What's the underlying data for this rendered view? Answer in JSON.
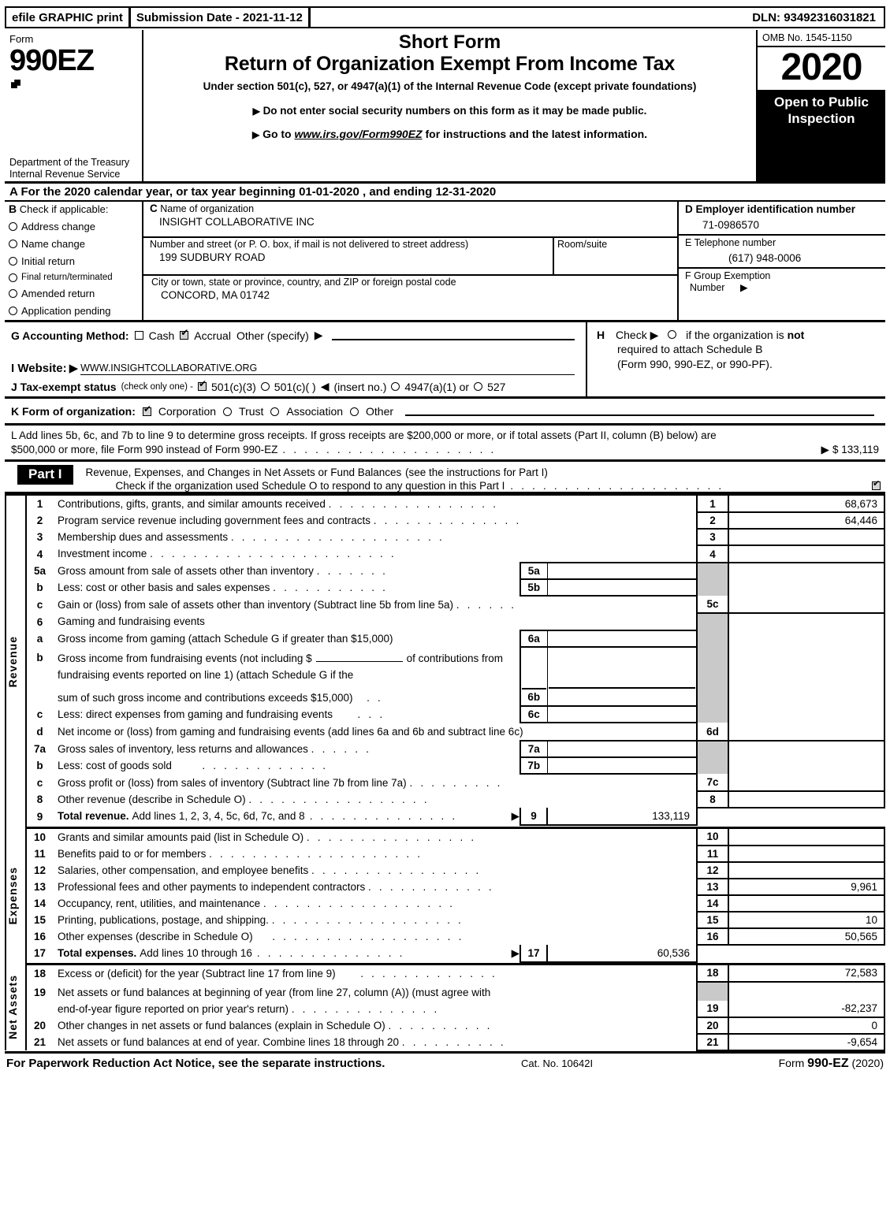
{
  "efile": {
    "print_label": "efile GRAPHIC print",
    "submission_label": "Submission Date - 2021-11-12",
    "dln": "DLN: 93492316031821"
  },
  "masthead": {
    "form_word": "Form",
    "form_number": "990EZ",
    "department": "Department of the Treasury Internal Revenue Service",
    "title_short": "Short Form",
    "title_main": "Return of Organization Exempt From Income Tax",
    "subtitle": "Under section 501(c), 527, or 4947(a)(1) of the Internal Revenue Code (except private foundations)",
    "bullet1": "Do not enter social security numbers on this form as it may be made public.",
    "bullet2_prefix": "Go to",
    "bullet2_link": "www.irs.gov/Form990EZ",
    "bullet2_suffix": "for instructions and the latest information.",
    "omb": "OMB No. 1545-1150",
    "year": "2020",
    "open_to_public": "Open to Public Inspection"
  },
  "line_a": "A  For the 2020 calendar year, or tax year beginning 01-01-2020 , and ending 12-31-2020",
  "section_b": {
    "letter": "B",
    "heading": "Check if applicable:",
    "items": [
      {
        "label": "Address change",
        "checked": false
      },
      {
        "label": "Name change",
        "checked": false
      },
      {
        "label": "Initial return",
        "checked": false
      },
      {
        "label": "Final return/terminated",
        "checked": false
      },
      {
        "label": "Amended return",
        "checked": false
      },
      {
        "label": "Application pending",
        "checked": false
      }
    ]
  },
  "section_c": {
    "letter": "C",
    "name_label": "Name of organization",
    "name_value": "INSIGHT COLLABORATIVE INC",
    "street_label": "Number and street (or P. O. box, if mail is not delivered to street address)",
    "street_value": "199 SUDBURY ROAD",
    "room_label": "Room/suite",
    "room_value": "",
    "city_label": "City or town, state or province, country, and ZIP or foreign postal code",
    "city_value": "CONCORD, MA  01742"
  },
  "section_d": {
    "ein_label": "D Employer identification number",
    "ein_value": "71-0986570",
    "phone_label": "E Telephone number",
    "phone_value": "(617) 948-0006",
    "group_label": "F Group Exemption",
    "group_label2": "Number",
    "group_value": ""
  },
  "section_g": {
    "label": "G Accounting Method:",
    "cash_label": "Cash",
    "cash_checked": false,
    "accrual_label": "Accrual",
    "accrual_checked": true,
    "other_label": "Other (specify)",
    "other_value": ""
  },
  "section_h": {
    "line1_a": "H",
    "line1_b": "Check",
    "line1_c": "if the organization is",
    "line1_not": "not",
    "line2": "required to attach Schedule B",
    "line3": "(Form 990, 990-EZ, or 990-PF)."
  },
  "section_i": {
    "label": "I Website:",
    "value": "WWW.INSIGHTCOLLABORATIVE.ORG"
  },
  "section_j": {
    "label": "J Tax-exempt status",
    "note": "(check only one) -",
    "opt1": "501(c)(3)",
    "opt1_checked": true,
    "opt2": "501(c)(    )",
    "opt2_checked": false,
    "insert": "(insert no.)",
    "opt3": "4947(a)(1) or",
    "opt3_checked": false,
    "opt4": "527",
    "opt4_checked": false
  },
  "section_k": {
    "label": "K Form of organization:",
    "opts": [
      {
        "label": "Corporation",
        "checked": true
      },
      {
        "label": "Trust",
        "checked": false
      },
      {
        "label": "Association",
        "checked": false
      },
      {
        "label": "Other",
        "checked": false
      }
    ]
  },
  "section_l": {
    "text1": "L Add lines 5b, 6c, and 7b to line 9 to determine gross receipts. If gross receipts are $200,000 or more, or if total assets (Part II, column (B) below) are",
    "text2": "$500,000 or more, file Form 990 instead of Form 990-EZ",
    "amount": "$ 133,119"
  },
  "part_i": {
    "badge": "Part I",
    "title": "Revenue, Expenses, and Changes in Net Assets or Fund Balances",
    "title_note": "(see the instructions for Part I)",
    "check_text": "Check if the organization used Schedule O to respond to any question in this Part I",
    "checked": true,
    "side_revenue": "Revenue",
    "side_expenses": "Expenses",
    "side_netassets": "Net Assets"
  },
  "chart_data": {
    "type": "table",
    "title": "Form 990-EZ Part I — Revenue, Expenses, and Changes in Net Assets",
    "revenue_rows": [
      {
        "no": "1",
        "sub": "",
        "desc": "Contributions, gifts, grants, and similar amounts received",
        "linelbl": "1",
        "value": "68,673"
      },
      {
        "no": "2",
        "sub": "",
        "desc": "Program service revenue including government fees and contracts",
        "linelbl": "2",
        "value": "64,446"
      },
      {
        "no": "3",
        "sub": "",
        "desc": "Membership dues and assessments",
        "linelbl": "3",
        "value": ""
      },
      {
        "no": "4",
        "sub": "",
        "desc": "Investment income",
        "linelbl": "4",
        "value": ""
      },
      {
        "no": "5a",
        "sub": "5a",
        "desc": "Gross amount from sale of assets other than inventory",
        "linelbl": "",
        "value": ""
      },
      {
        "no": "b",
        "sub": "5b",
        "desc": "Less: cost or other basis and sales expenses",
        "linelbl": "",
        "value": ""
      },
      {
        "no": "c",
        "sub": "",
        "desc": "Gain or (loss) from sale of assets other than inventory (Subtract line 5b from line 5a)",
        "linelbl": "5c",
        "value": ""
      },
      {
        "no": "6",
        "sub": "",
        "desc": "Gaming and fundraising events",
        "linelbl": "",
        "value": ""
      },
      {
        "no": "a",
        "sub": "6a",
        "desc": "Gross income from gaming (attach Schedule G if greater than $15,000)",
        "linelbl": "",
        "value": ""
      },
      {
        "no": "b",
        "sub": "6b",
        "desc": "Gross income from fundraising events (not including $______ of contributions from fundraising events reported on line 1) (attach Schedule G if the sum of such gross income and contributions exceeds $15,000)",
        "linelbl": "",
        "value": ""
      },
      {
        "no": "c",
        "sub": "6c",
        "desc": "Less: direct expenses from gaming and fundraising events",
        "linelbl": "",
        "value": ""
      },
      {
        "no": "d",
        "sub": "",
        "desc": "Net income or (loss) from gaming and fundraising events (add lines 6a and 6b and subtract line 6c)",
        "linelbl": "6d",
        "value": ""
      },
      {
        "no": "7a",
        "sub": "7a",
        "desc": "Gross sales of inventory, less returns and allowances",
        "linelbl": "",
        "value": ""
      },
      {
        "no": "b",
        "sub": "7b",
        "desc": "Less: cost of goods sold",
        "linelbl": "",
        "value": ""
      },
      {
        "no": "c",
        "sub": "",
        "desc": "Gross profit or (loss) from sales of inventory (Subtract line 7b from line 7a)",
        "linelbl": "7c",
        "value": ""
      },
      {
        "no": "8",
        "sub": "",
        "desc": "Other revenue (describe in Schedule O)",
        "linelbl": "8",
        "value": ""
      },
      {
        "no": "9",
        "sub": "",
        "desc": "Total revenue. Add lines 1, 2, 3, 4, 5c, 6d, 7c, and 8",
        "linelbl": "9",
        "value": "133,119"
      }
    ],
    "expense_rows": [
      {
        "no": "10",
        "desc": "Grants and similar amounts paid (list in Schedule O)",
        "linelbl": "10",
        "value": ""
      },
      {
        "no": "11",
        "desc": "Benefits paid to or for members",
        "linelbl": "11",
        "value": ""
      },
      {
        "no": "12",
        "desc": "Salaries, other compensation, and employee benefits",
        "linelbl": "12",
        "value": ""
      },
      {
        "no": "13",
        "desc": "Professional fees and other payments to independent contractors",
        "linelbl": "13",
        "value": "9,961"
      },
      {
        "no": "14",
        "desc": "Occupancy, rent, utilities, and maintenance",
        "linelbl": "14",
        "value": ""
      },
      {
        "no": "15",
        "desc": "Printing, publications, postage, and shipping.",
        "linelbl": "15",
        "value": "10"
      },
      {
        "no": "16",
        "desc": "Other expenses (describe in Schedule O)",
        "linelbl": "16",
        "value": "50,565"
      },
      {
        "no": "17",
        "desc": "Total expenses. Add lines 10 through 16",
        "linelbl": "17",
        "value": "60,536"
      }
    ],
    "netasset_rows": [
      {
        "no": "18",
        "desc": "Excess or (deficit) for the year (Subtract line 17 from line 9)",
        "linelbl": "18",
        "value": "72,583"
      },
      {
        "no": "19",
        "desc": "Net assets or fund balances at beginning of year (from line 27, column (A)) (must agree with end-of-year figure reported on prior year's return)",
        "linelbl": "19",
        "value": "-82,237"
      },
      {
        "no": "20",
        "desc": "Other changes in net assets or fund balances (explain in Schedule O)",
        "linelbl": "20",
        "value": "0"
      },
      {
        "no": "21",
        "desc": "Net assets or fund balances at end of year. Combine lines 18 through 20",
        "linelbl": "21",
        "value": "-9,654"
      }
    ]
  },
  "rows": {
    "r1_desc": "Contributions, gifts, grants, and similar amounts received",
    "r1_lbl": "1",
    "r1_val": "68,673",
    "r2_desc": "Program service revenue including government fees and contracts",
    "r2_lbl": "2",
    "r2_val": "64,446",
    "r3_desc": "Membership dues and assessments",
    "r3_lbl": "3",
    "r3_val": "",
    "r4_desc": "Investment income",
    "r4_lbl": "4",
    "r4_val": "",
    "r5a_no": "5a",
    "r5a_desc": "Gross amount from sale of assets other than inventory",
    "r5a_sub": "5a",
    "r5b_no": "b",
    "r5b_desc": "Less: cost or other basis and sales expenses",
    "r5b_sub": "5b",
    "r5c_no": "c",
    "r5c_desc": "Gain or (loss) from sale of assets other than inventory (Subtract line 5b from line 5a)",
    "r5c_lbl": "5c",
    "r5c_val": "",
    "r6_no": "6",
    "r6_desc": "Gaming and fundraising events",
    "r6a_no": "a",
    "r6a_desc": "Gross income from gaming (attach Schedule G if greater than $15,000)",
    "r6a_sub": "6a",
    "r6b_no": "b",
    "r6b_desc1": "Gross income from fundraising events (not including $",
    "r6b_desc1b": "of contributions from",
    "r6b_desc2": "fundraising events reported on line 1) (attach Schedule G if the",
    "r6b_desc3": "sum of such gross income and contributions exceeds $15,000)",
    "r6b_sub": "6b",
    "r6c_no": "c",
    "r6c_desc": "Less: direct expenses from gaming and fundraising events",
    "r6c_sub": "6c",
    "r6d_no": "d",
    "r6d_desc": "Net income or (loss) from gaming and fundraising events (add lines 6a and 6b and subtract line 6c)",
    "r6d_lbl": "6d",
    "r6d_val": "",
    "r7a_no": "7a",
    "r7a_desc": "Gross sales of inventory, less returns and allowances",
    "r7a_sub": "7a",
    "r7b_no": "b",
    "r7b_desc": "Less: cost of goods sold",
    "r7b_sub": "7b",
    "r7c_no": "c",
    "r7c_desc": "Gross profit or (loss) from sales of inventory (Subtract line 7b from line 7a)",
    "r7c_lbl": "7c",
    "r7c_val": "",
    "r8_no": "8",
    "r8_desc": "Other revenue (describe in Schedule O)",
    "r8_lbl": "8",
    "r8_val": "",
    "r9_no": "9",
    "r9_desc_b": "Total revenue.",
    "r9_desc": "Add lines 1, 2, 3, 4, 5c, 6d, 7c, and 8",
    "r9_lbl": "9",
    "r9_val": "133,119",
    "r10_no": "10",
    "r10_desc": "Grants and similar amounts paid (list in Schedule O)",
    "r10_lbl": "10",
    "r10_val": "",
    "r11_no": "11",
    "r11_desc": "Benefits paid to or for members",
    "r11_lbl": "11",
    "r11_val": "",
    "r12_no": "12",
    "r12_desc": "Salaries, other compensation, and employee benefits",
    "r12_lbl": "12",
    "r12_val": "",
    "r13_no": "13",
    "r13_desc": "Professional fees and other payments to independent contractors",
    "r13_lbl": "13",
    "r13_val": "9,961",
    "r14_no": "14",
    "r14_desc": "Occupancy, rent, utilities, and maintenance",
    "r14_lbl": "14",
    "r14_val": "",
    "r15_no": "15",
    "r15_desc": "Printing, publications, postage, and shipping.",
    "r15_lbl": "15",
    "r15_val": "10",
    "r16_no": "16",
    "r16_desc": "Other expenses (describe in Schedule O)",
    "r16_lbl": "16",
    "r16_val": "50,565",
    "r17_no": "17",
    "r17_desc_b": "Total expenses.",
    "r17_desc": "Add lines 10 through 16",
    "r17_lbl": "17",
    "r17_val": "60,536",
    "r18_no": "18",
    "r18_desc": "Excess or (deficit) for the year (Subtract line 17 from line 9)",
    "r18_lbl": "18",
    "r18_val": "72,583",
    "r19_no": "19",
    "r19_desc1": "Net assets or fund balances at beginning of year (from line 27, column (A)) (must agree with",
    "r19_desc2": "end-of-year figure reported on prior year's return)",
    "r19_lbl": "19",
    "r19_val": "-82,237",
    "r20_no": "20",
    "r20_desc": "Other changes in net assets or fund balances (explain in Schedule O)",
    "r20_lbl": "20",
    "r20_val": "0",
    "r21_no": "21",
    "r21_desc": "Net assets or fund balances at end of year. Combine lines 18 through 20",
    "r21_lbl": "21",
    "r21_val": "-9,654"
  },
  "footer": {
    "left": "For Paperwork Reduction Act Notice, see the separate instructions.",
    "cat": "Cat. No. 10642I",
    "form_prefix": "Form",
    "form_bold": "990-EZ",
    "form_year": "(2020)"
  }
}
